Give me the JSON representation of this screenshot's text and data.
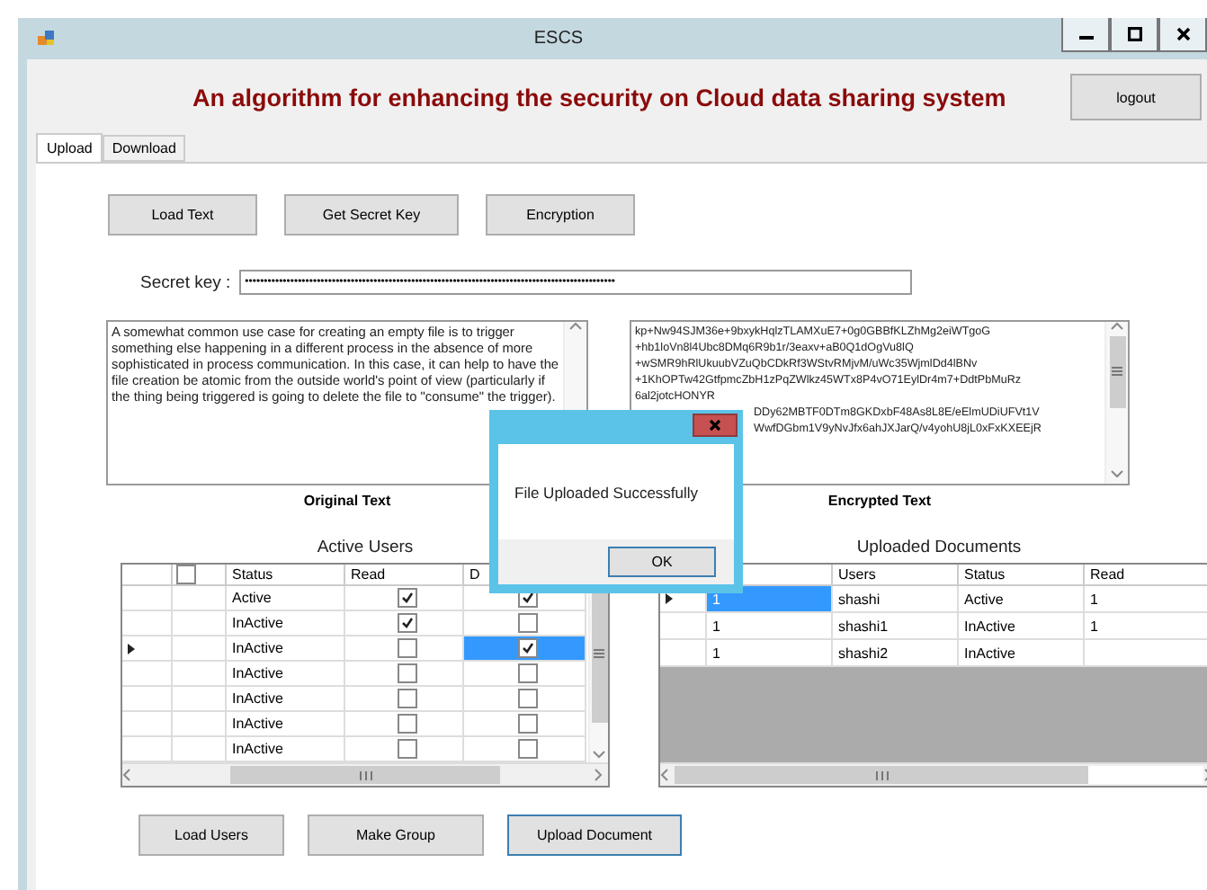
{
  "window": {
    "title": "ESCS"
  },
  "header": {
    "title": "An algorithm for enhancing the security on Cloud data sharing system",
    "logout": "logout"
  },
  "tabs": [
    {
      "label": "Upload",
      "selected": true
    },
    {
      "label": "Download",
      "selected": false
    }
  ],
  "top_buttons": [
    {
      "label": "Load Text",
      "focused": false
    },
    {
      "label": "Get Secret Key",
      "focused": false
    },
    {
      "label": "Encryption",
      "focused": false
    }
  ],
  "secret_key": {
    "label": "Secret key :",
    "value": "••••••••••••••••••••••••••••••••••••••••••••••••••••••••••••••••••••••••••••••••••••••••••••••••••"
  },
  "original_text": {
    "caption": "Original Text",
    "value": "A somewhat common use case for creating an empty file is to trigger something else happening in a different process in the absence of more sophisticated in process communication. In this case, it can help to have the file creation be atomic from the outside world's point of view (particularly if the thing being triggered is going to delete the file to \"consume\" the trigger)."
  },
  "encrypted_text": {
    "caption": "Encrypted Text",
    "lines": [
      {
        "text": "kp+Nw94SJM36e+9bxykHqlzTLAMXuE7+0g0GBBfKLZhMg2eiWTgoG",
        "kind": "full"
      },
      {
        "text": "+hb1loVn8l4Ubc8DMq6R9b1r/3eaxv+aB0Q1dOgVu8lQ",
        "kind": "full"
      },
      {
        "text": "+wSMR9hRlUkuubVZuQbCDkRf3WStvRMjvM/uWc35WjmlDd4lBNv",
        "kind": "full"
      },
      {
        "text": "+1KhOPTw42GtfpmcZbH1zPqZWlkz45WTx8P4vO71EylDr4m7+DdtPbMuRz",
        "kind": "full"
      },
      {
        "text": "6al2jotcHONYR",
        "kind": "full"
      },
      {
        "text": "DDy62MBTF0DTm8GKDxbF48As8L8E/eElmUDiUFVt1V",
        "kind": "partial"
      },
      {
        "text": "WwfDGbm1V9yNvJfx6ahJXJarQ/v4yohU8jL0xFxKXEEjR",
        "kind": "partial"
      }
    ]
  },
  "active_users": {
    "title": "Active Users",
    "columns": [
      "Status",
      "Read",
      "D"
    ],
    "header_checked": false,
    "rows": [
      {
        "status": "Active",
        "read": true,
        "d": true,
        "selected": false
      },
      {
        "status": "InActive",
        "read": true,
        "d": false,
        "selected": false
      },
      {
        "status": "InActive",
        "read": false,
        "d": true,
        "selected": true
      },
      {
        "status": "InActive",
        "read": false,
        "d": false,
        "selected": false
      },
      {
        "status": "InActive",
        "read": false,
        "d": false,
        "selected": false
      },
      {
        "status": "InActive",
        "read": false,
        "d": false,
        "selected": false
      },
      {
        "status": "InActive",
        "read": false,
        "d": false,
        "selected": false
      }
    ]
  },
  "uploaded_documents": {
    "title": "Uploaded Documents",
    "columns": [
      "",
      "Users",
      "Status",
      "Read"
    ],
    "rows": [
      {
        "cells": [
          "1",
          "shashi",
          "Active",
          "1"
        ],
        "selected": true
      },
      {
        "cells": [
          "1",
          "shashi1",
          "InActive",
          "1"
        ],
        "selected": false
      },
      {
        "cells": [
          "1",
          "shashi2",
          "InActive",
          ""
        ],
        "selected": false
      }
    ]
  },
  "bottom_buttons": [
    {
      "label": "Load Users",
      "focused": false
    },
    {
      "label": "Make Group",
      "focused": false
    },
    {
      "label": "Upload Document",
      "focused": true
    }
  ],
  "dialog": {
    "message": "File Uploaded Successfully",
    "button": "OK"
  }
}
